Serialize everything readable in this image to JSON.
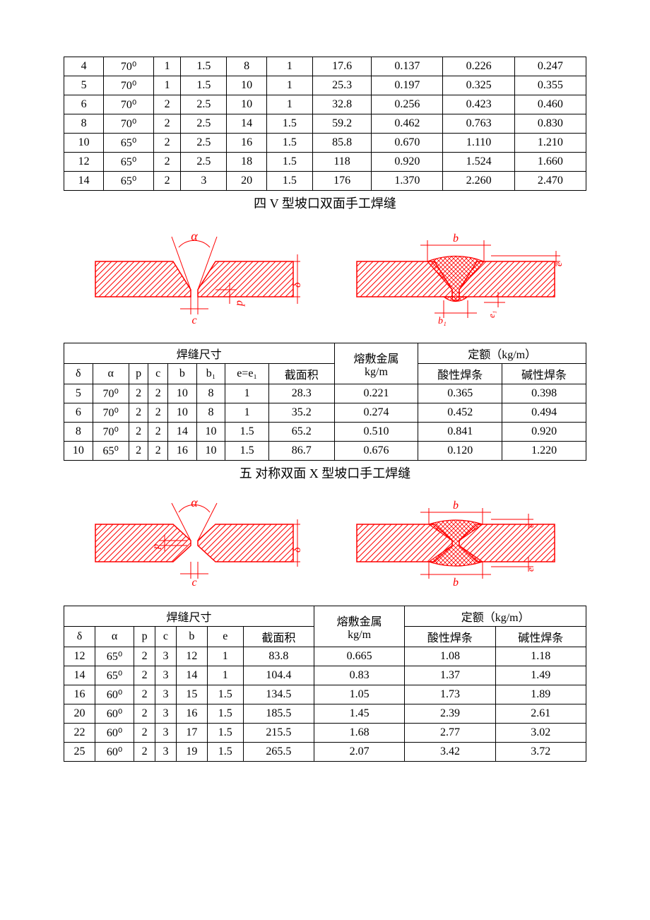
{
  "section4": {
    "title": "四  V 型坡口双面手工焊缝",
    "table_top_rows": [
      [
        "4",
        "70⁰",
        "1",
        "1.5",
        "8",
        "1",
        "17.6",
        "0.137",
        "0.226",
        "0.247"
      ],
      [
        "5",
        "70⁰",
        "1",
        "1.5",
        "10",
        "1",
        "25.3",
        "0.197",
        "0.325",
        "0.355"
      ],
      [
        "6",
        "70⁰",
        "2",
        "2.5",
        "10",
        "1",
        "32.8",
        "0.256",
        "0.423",
        "0.460"
      ],
      [
        "8",
        "70⁰",
        "2",
        "2.5",
        "14",
        "1.5",
        "59.2",
        "0.462",
        "0.763",
        "0.830"
      ],
      [
        "10",
        "65⁰",
        "2",
        "2.5",
        "16",
        "1.5",
        "85.8",
        "0.670",
        "1.110",
        "1.210"
      ],
      [
        "12",
        "65⁰",
        "2",
        "2.5",
        "18",
        "1.5",
        "118",
        "0.920",
        "1.524",
        "1.660"
      ],
      [
        "14",
        "65⁰",
        "2",
        "3",
        "20",
        "1.5",
        "176",
        "1.370",
        "2.260",
        "2.470"
      ]
    ],
    "diag_labels": {
      "a": "α",
      "c": "c",
      "p": "p",
      "delta": "δ",
      "b": "b",
      "b1": "b₁",
      "e1": "e₁",
      "e": "e"
    },
    "header": {
      "dim_label": "焊缝尺寸",
      "melt_label": "熔敷金属",
      "melt_unit": "kg/m",
      "quota_label": "定额（kg/m）",
      "cols": [
        "δ",
        "α",
        "p",
        "c",
        "b",
        "b₁",
        "e=e₁",
        "截面积"
      ],
      "acid": "酸性焊条",
      "alk": "碱性焊条"
    },
    "table_bottom_rows": [
      [
        "5",
        "70⁰",
        "2",
        "2",
        "10",
        "8",
        "1",
        "28.3",
        "0.221",
        "0.365",
        "0.398"
      ],
      [
        "6",
        "70⁰",
        "2",
        "2",
        "10",
        "8",
        "1",
        "35.2",
        "0.274",
        "0.452",
        "0.494"
      ],
      [
        "8",
        "70⁰",
        "2",
        "2",
        "14",
        "10",
        "1.5",
        "65.2",
        "0.510",
        "0.841",
        "0.920"
      ],
      [
        "10",
        "65⁰",
        "2",
        "2",
        "16",
        "10",
        "1.5",
        "86.7",
        "0.676",
        "0.120",
        "1.220"
      ]
    ]
  },
  "section5": {
    "title": "五  对称双面 X 型坡口手工焊缝",
    "diag_labels": {
      "a": "α",
      "c": "c",
      "p": "p",
      "delta": "δ",
      "b": "b",
      "e": "e"
    },
    "header": {
      "dim_label": "焊缝尺寸",
      "melt_label": "熔敷金属",
      "melt_unit": "kg/m",
      "quota_label": "定额（kg/m）",
      "cols": [
        "δ",
        "α",
        "p",
        "c",
        "b",
        "e",
        "截面积"
      ],
      "acid": "酸性焊条",
      "alk": "碱性焊条"
    },
    "table_rows": [
      [
        "12",
        "65⁰",
        "2",
        "3",
        "12",
        "1",
        "83.8",
        "0.665",
        "1.08",
        "1.18"
      ],
      [
        "14",
        "65⁰",
        "2",
        "3",
        "14",
        "1",
        "104.4",
        "0.83",
        "1.37",
        "1.49"
      ],
      [
        "16",
        "60⁰",
        "2",
        "3",
        "15",
        "1.5",
        "134.5",
        "1.05",
        "1.73",
        "1.89"
      ],
      [
        "20",
        "60⁰",
        "2",
        "3",
        "16",
        "1.5",
        "185.5",
        "1.45",
        "2.39",
        "2.61"
      ],
      [
        "22",
        "60⁰",
        "2",
        "3",
        "17",
        "1.5",
        "215.5",
        "1.68",
        "2.77",
        "3.02"
      ],
      [
        "25",
        "60⁰",
        "2",
        "3",
        "19",
        "1.5",
        "265.5",
        "2.07",
        "3.42",
        "3.72"
      ]
    ]
  }
}
